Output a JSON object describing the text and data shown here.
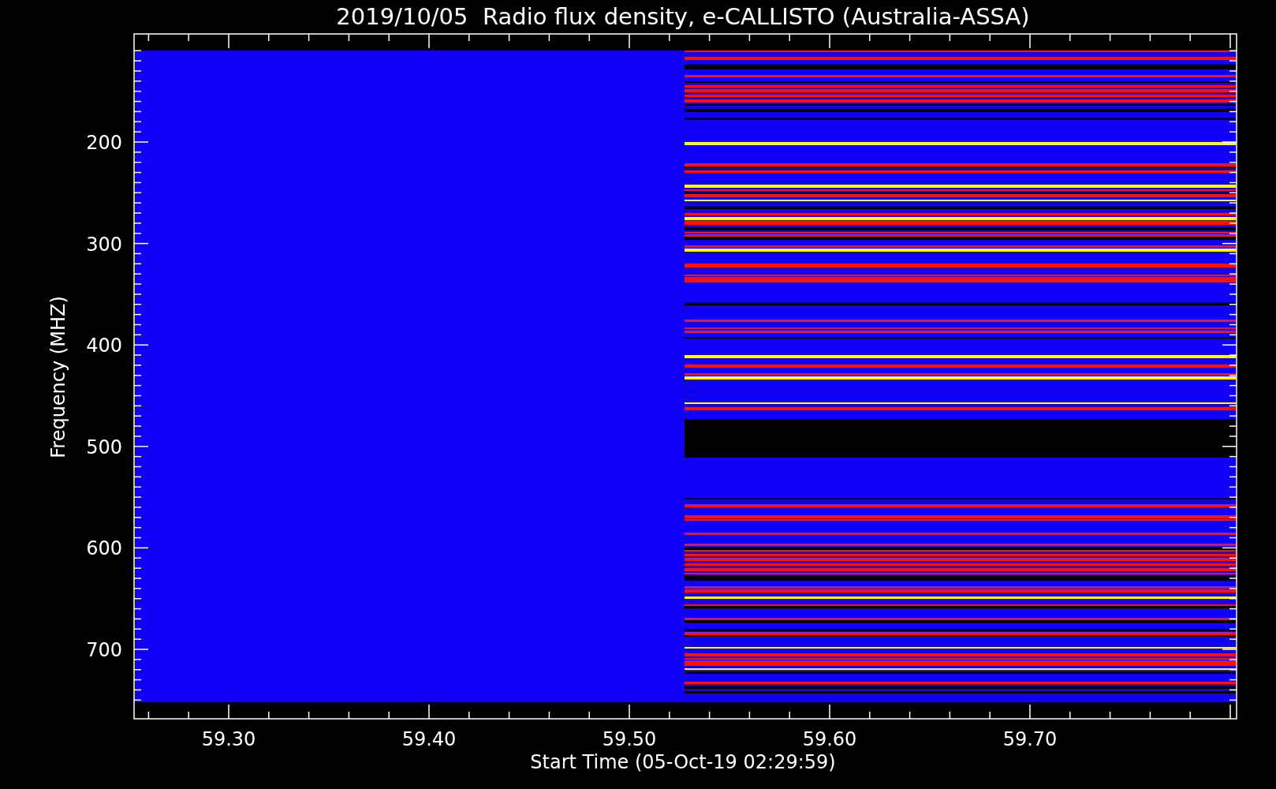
{
  "plot": {
    "title": "2019/10/05  Radio flux density, e-CALLISTO (Australia-ASSA)",
    "xlabel": "Start Time (05-Oct-19 02:29:59)",
    "ylabel": "Frequency (MHZ)",
    "xtick_labels": [
      "59.30",
      "59.40",
      "59.50",
      "59.60",
      "59.70"
    ],
    "ytick_labels": [
      "200",
      "300",
      "400",
      "500",
      "600",
      "700"
    ]
  }
}
